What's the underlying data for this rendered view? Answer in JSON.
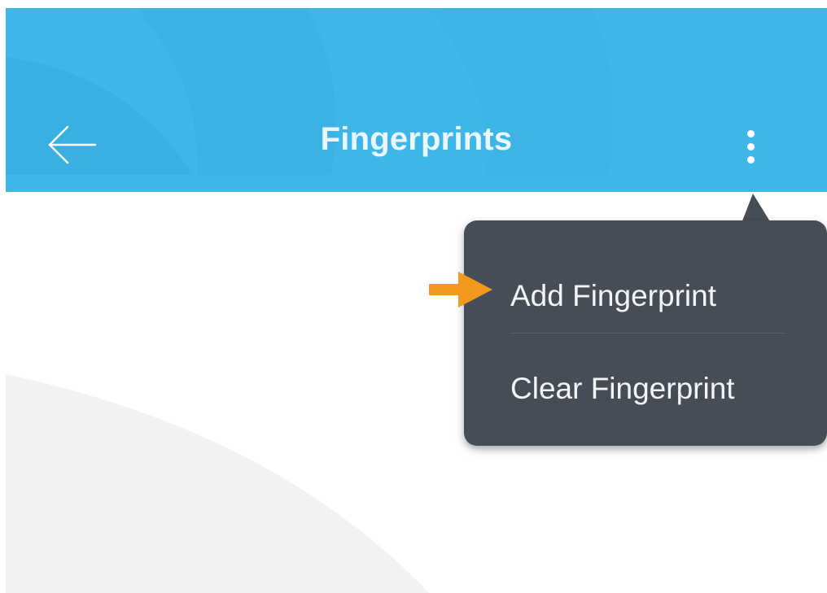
{
  "app_bar": {
    "title": "Fingerprints",
    "back_icon": "arrow-left-icon",
    "more_icon": "more-vert-icon",
    "background_color": "#3eb7e8"
  },
  "overflow_menu": {
    "background_color": "#464d56",
    "items": [
      {
        "label": "Add Fingerprint",
        "highlighted": true
      },
      {
        "label": "Clear Fingerprint",
        "highlighted": false
      }
    ]
  },
  "annotation": {
    "pointer_icon": "orange-arrow-icon",
    "color": "#f39a1e"
  }
}
